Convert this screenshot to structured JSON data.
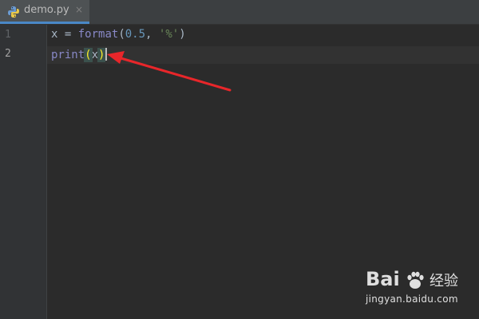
{
  "tab": {
    "filename": "demo.py",
    "close_glyph": "×",
    "icon": "python-file-icon"
  },
  "gutter": {
    "line1": "1",
    "line2": "2"
  },
  "code": {
    "line1": {
      "var": "x",
      "op": " = ",
      "fn": "format",
      "open": "(",
      "num": "0.5",
      "comma": ", ",
      "str": "'%'",
      "close": ")"
    },
    "line2": {
      "fn": "print",
      "open": "(",
      "arg": "x",
      "close": ")"
    }
  },
  "annotation": {
    "arrow_color": "#e8262a"
  },
  "watermark": {
    "logo_text": "Bai",
    "cn_text": "经验",
    "url": "jingyan.baidu.com"
  },
  "colors": {
    "background": "#2b2b2b",
    "gutter": "#313335",
    "tab_active": "#4e5254",
    "accent": "#4a88c7"
  }
}
